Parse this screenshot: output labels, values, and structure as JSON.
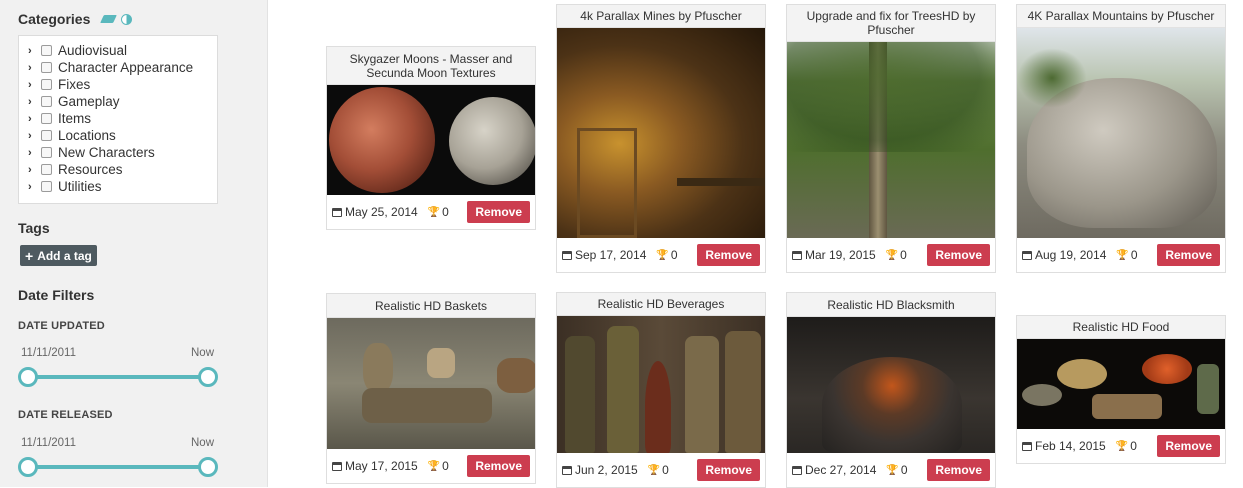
{
  "sidebar": {
    "categories_title": "Categories",
    "categories": [
      "Audiovisual",
      "Character Appearance",
      "Fixes",
      "Gameplay",
      "Items",
      "Locations",
      "New Characters",
      "Resources",
      "Utilities"
    ],
    "tags_title": "Tags",
    "add_tag_label": "Add a tag",
    "date_filters_title": "Date Filters",
    "date_updated_label": "DATE UPDATED",
    "date_released_label": "DATE RELEASED",
    "updated_from": "11/11/2011",
    "updated_to": "Now",
    "released_from": "11/11/2011",
    "released_to": "Now",
    "accent_color": "#5ab8bd"
  },
  "cards": [
    {
      "title": "Skygazer Moons - Masser and Secunda Moon Textures",
      "date": "May 25, 2014",
      "endorsements": "0",
      "remove_label": "Remove"
    },
    {
      "title": "4k Parallax Mines by Pfuscher",
      "date": "Sep 17, 2014",
      "endorsements": "0",
      "remove_label": "Remove"
    },
    {
      "title": "Upgrade and fix for TreesHD by Pfuscher",
      "date": "Mar 19, 2015",
      "endorsements": "0",
      "remove_label": "Remove"
    },
    {
      "title": "4K Parallax Mountains by Pfuscher",
      "date": "Aug 19, 2014",
      "endorsements": "0",
      "remove_label": "Remove"
    },
    {
      "title": "Realistic HD Baskets",
      "date": "May 17, 2015",
      "endorsements": "0",
      "remove_label": "Remove"
    },
    {
      "title": "Realistic HD Beverages",
      "date": "Jun 2, 2015",
      "endorsements": "0",
      "remove_label": "Remove"
    },
    {
      "title": "Realistic HD Blacksmith",
      "date": "Dec 27, 2014",
      "endorsements": "0",
      "remove_label": "Remove"
    },
    {
      "title": "Realistic HD Food",
      "date": "Feb 14, 2015",
      "endorsements": "0",
      "remove_label": "Remove"
    }
  ],
  "remove_color": "#cc3d4f"
}
